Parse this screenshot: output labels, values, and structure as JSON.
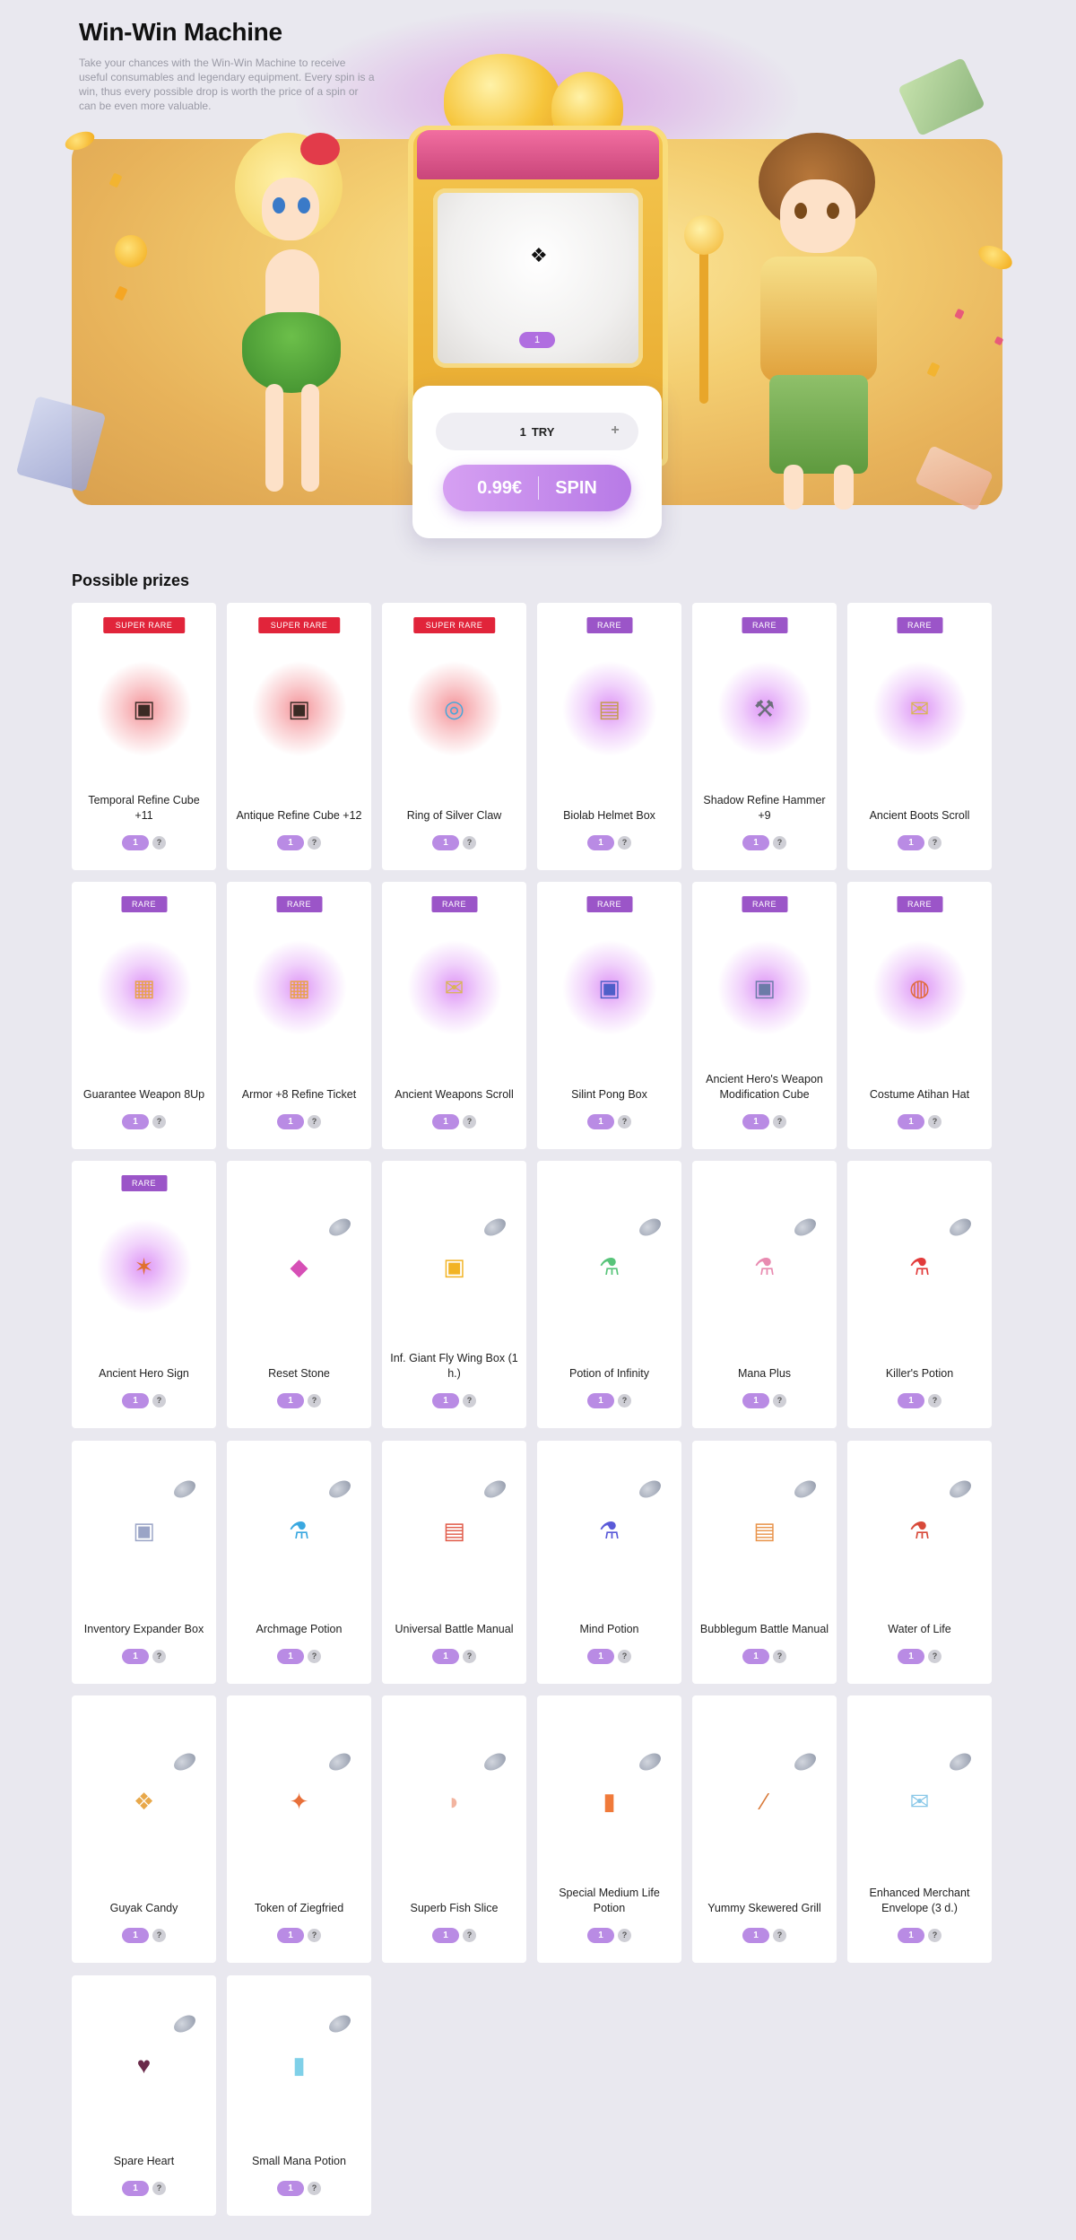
{
  "page": {
    "title": "Win-Win Machine",
    "description": "Take your chances with the Win-Win Machine to receive useful consumables and legendary equipment. Every spin is a win, thus every possible drop is worth the price of a spin or can be even more valuable."
  },
  "machine": {
    "screen_qty": "1",
    "tries_count": "1",
    "tries_label": "TRY",
    "plus_label": "+",
    "price": "0.99€",
    "spin_label": "SPIN"
  },
  "prizes": {
    "title": "Possible prizes",
    "help_label": "?",
    "items": [
      {
        "name": "Temporal Refine Cube +11",
        "tag": "SUPER RARE",
        "qty": "1",
        "glyph": "▣",
        "color": "#3a2a24"
      },
      {
        "name": "Antique Refine Cube +12",
        "tag": "SUPER RARE",
        "qty": "1",
        "glyph": "▣",
        "color": "#3a2a24"
      },
      {
        "name": "Ring of Silver Claw",
        "tag": "SUPER RARE",
        "qty": "1",
        "glyph": "◎",
        "color": "#4aa6d8"
      },
      {
        "name": "Biolab Helmet Box",
        "tag": "RARE",
        "qty": "1",
        "glyph": "▤",
        "color": "#c49a52"
      },
      {
        "name": "Shadow Refine Hammer +9",
        "tag": "RARE",
        "qty": "1",
        "glyph": "⚒",
        "color": "#6b6f7a"
      },
      {
        "name": "Ancient Boots Scroll",
        "tag": "RARE",
        "qty": "1",
        "glyph": "✉",
        "color": "#d9b35a"
      },
      {
        "name": "Guarantee Weapon 8Up",
        "tag": "RARE",
        "qty": "1",
        "glyph": "▦",
        "color": "#e8a14a"
      },
      {
        "name": "Armor +8 Refine Ticket",
        "tag": "RARE",
        "qty": "1",
        "glyph": "▦",
        "color": "#e8a14a"
      },
      {
        "name": "Ancient Weapons Scroll",
        "tag": "RARE",
        "qty": "1",
        "glyph": "✉",
        "color": "#d9b35a"
      },
      {
        "name": "Silint Pong Box",
        "tag": "RARE",
        "qty": "1",
        "glyph": "▣",
        "color": "#4e5fc8"
      },
      {
        "name": "Ancient Hero's Weapon Modification Cube",
        "tag": "RARE",
        "qty": "1",
        "glyph": "▣",
        "color": "#6c7ba8"
      },
      {
        "name": "Costume Atihan Hat",
        "tag": "RARE",
        "qty": "1",
        "glyph": "◍",
        "color": "#e06a3b"
      },
      {
        "name": "Ancient Hero Sign",
        "tag": "RARE",
        "qty": "1",
        "glyph": "✶",
        "color": "#e0702e"
      },
      {
        "name": "Reset Stone",
        "tag": "",
        "qty": "1",
        "glyph": "◆",
        "color": "#d64fb6"
      },
      {
        "name": "Inf. Giant Fly Wing Box (1 h.)",
        "tag": "",
        "qty": "1",
        "glyph": "▣",
        "color": "#f2b323"
      },
      {
        "name": "Potion of Infinity",
        "tag": "",
        "qty": "1",
        "glyph": "⚗",
        "color": "#58c47a"
      },
      {
        "name": "Mana Plus",
        "tag": "",
        "qty": "1",
        "glyph": "⚗",
        "color": "#e88ab0"
      },
      {
        "name": "Killer's Potion",
        "tag": "",
        "qty": "1",
        "glyph": "⚗",
        "color": "#e23b3b"
      },
      {
        "name": "Inventory Expander Box",
        "tag": "",
        "qty": "1",
        "glyph": "▣",
        "color": "#9aa4c6"
      },
      {
        "name": "Archmage Potion",
        "tag": "",
        "qty": "1",
        "glyph": "⚗",
        "color": "#3aa8e0"
      },
      {
        "name": "Universal Battle Manual",
        "tag": "",
        "qty": "1",
        "glyph": "▤",
        "color": "#e05a48"
      },
      {
        "name": "Mind Potion",
        "tag": "",
        "qty": "1",
        "glyph": "⚗",
        "color": "#5a5ad8"
      },
      {
        "name": "Bubblegum Battle Manual",
        "tag": "",
        "qty": "1",
        "glyph": "▤",
        "color": "#e8934a"
      },
      {
        "name": "Water of Life",
        "tag": "",
        "qty": "1",
        "glyph": "⚗",
        "color": "#d84a3a"
      },
      {
        "name": "Guyak Candy",
        "tag": "",
        "qty": "1",
        "glyph": "❖",
        "color": "#e8a84a"
      },
      {
        "name": "Token of Ziegfried",
        "tag": "",
        "qty": "1",
        "glyph": "✦",
        "color": "#e8703a"
      },
      {
        "name": "Superb Fish Slice",
        "tag": "",
        "qty": "1",
        "glyph": "◗",
        "color": "#f2b4a0"
      },
      {
        "name": "Special Medium Life Potion",
        "tag": "",
        "qty": "1",
        "glyph": "▮",
        "color": "#f07a3a"
      },
      {
        "name": "Yummy Skewered Grill",
        "tag": "",
        "qty": "1",
        "glyph": "⁄",
        "color": "#d87a3a"
      },
      {
        "name": "Enhanced Merchant Envelope (3 d.)",
        "tag": "",
        "qty": "1",
        "glyph": "✉",
        "color": "#8ac8e8"
      },
      {
        "name": "Spare Heart",
        "tag": "",
        "qty": "1",
        "glyph": "♥",
        "color": "#6a2a4a"
      },
      {
        "name": "Small Mana Potion",
        "tag": "",
        "qty": "1",
        "glyph": "▮",
        "color": "#7fd0e8"
      }
    ]
  }
}
